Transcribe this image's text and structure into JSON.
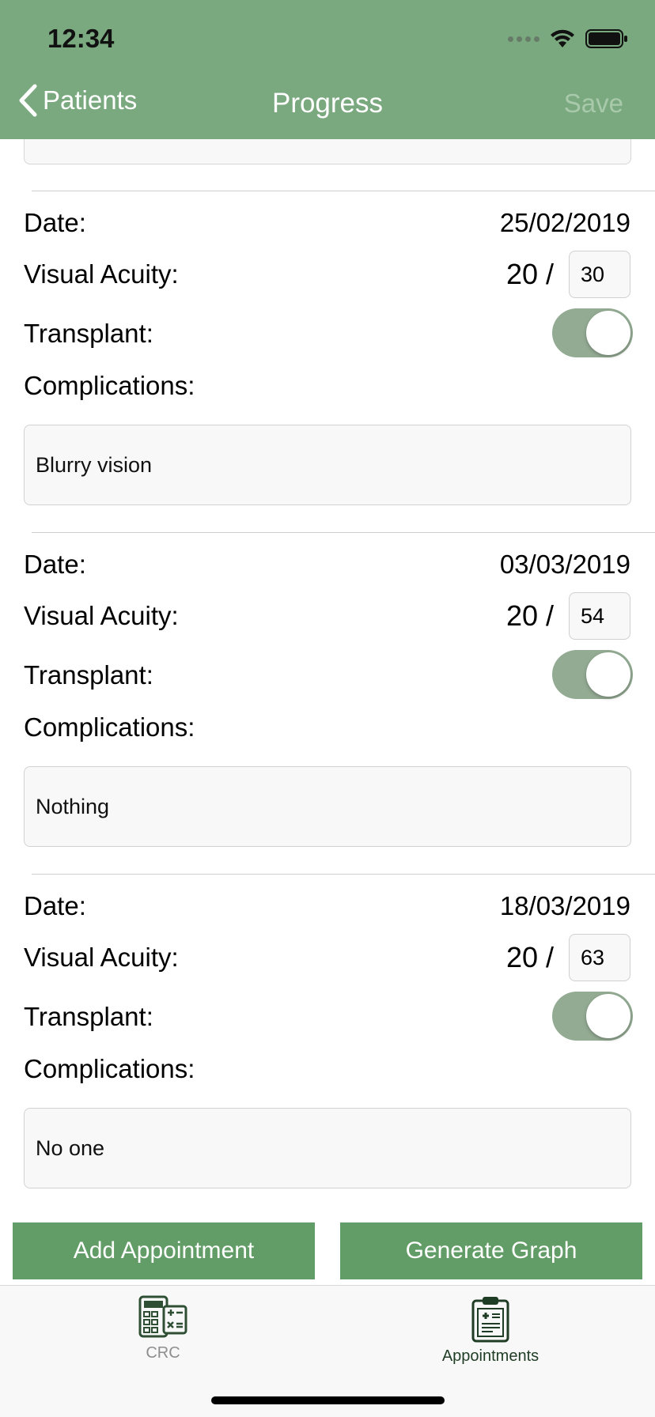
{
  "status_bar": {
    "time": "12:34"
  },
  "nav": {
    "back_label": "Patients",
    "title": "Progress",
    "save_label": "Save"
  },
  "labels": {
    "date": "Date:",
    "visual_acuity": "Visual Acuity:",
    "transplant": "Transplant:",
    "complications": "Complications:",
    "va_prefix": "20 /"
  },
  "entries": [
    {
      "date": "25/02/2019",
      "visual_acuity": "30",
      "transplant": true,
      "complications": "Blurry vision"
    },
    {
      "date": "03/03/2019",
      "visual_acuity": "54",
      "transplant": true,
      "complications": "Nothing"
    },
    {
      "date": "18/03/2019",
      "visual_acuity": "63",
      "transplant": true,
      "complications": "No one"
    }
  ],
  "actions": {
    "add_label": "Add Appointment",
    "graph_label": "Generate Graph"
  },
  "tabbar": {
    "items": [
      {
        "label": "CRC",
        "icon": "calculator-icon",
        "active": false
      },
      {
        "label": "Appointments",
        "icon": "clipboard-icon",
        "active": true
      }
    ]
  },
  "colors": {
    "header": "#7aa97f",
    "button": "#629c66",
    "toggle_on": "#93aa93",
    "active_tab": "#1f3d24"
  }
}
